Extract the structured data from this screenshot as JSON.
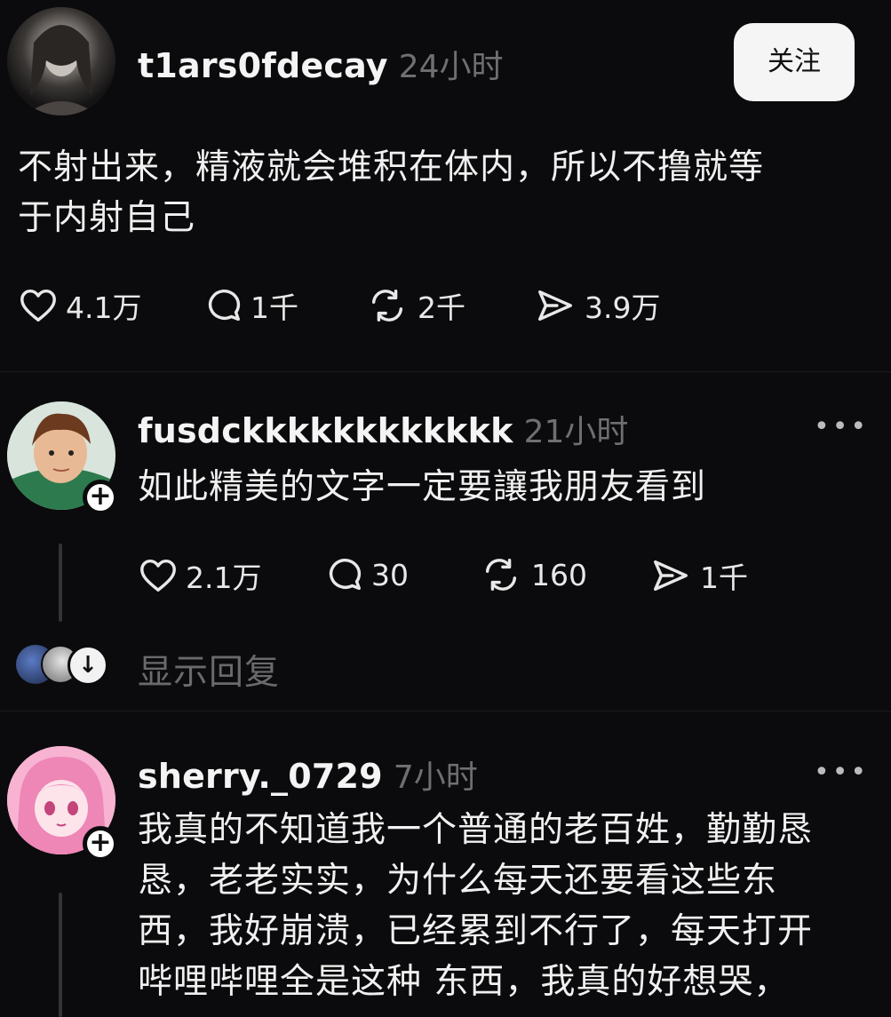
{
  "post": {
    "username": "t1ars0fdecay",
    "time": "24小时",
    "follow_label": "关注",
    "text_line1": "不射出来，精液就会堆积在体内，所以不撸就等",
    "text_line2": "于内射自己",
    "likes": "4.1万",
    "comments": "1千",
    "reposts": "2千",
    "shares": "3.9万"
  },
  "reply1": {
    "username": "fusdckkkkkkkkkkkk",
    "time": "21小时",
    "text": "如此精美的文字一定要讓我朋友看到",
    "likes": "2.1万",
    "comments": "30",
    "reposts": "160",
    "shares": "1千",
    "show_replies_label": "显示回复"
  },
  "reply2": {
    "username": "sherry._0729",
    "time": "7小时",
    "text_line1": "我真的不知道我一个普通的老百姓，勤勤恳",
    "text_line2": "恳，老老实实，为什么每天还要看这些东",
    "text_line3": "西，我好崩溃，已经累到不行了，每天打开",
    "text_line4": "哔哩哔哩全是这种 东西，我真的好想哭，"
  },
  "colors": {
    "background": "#0b0b0d",
    "muted_text": "#6f6f73",
    "follow_button": "#f5f5f5"
  }
}
